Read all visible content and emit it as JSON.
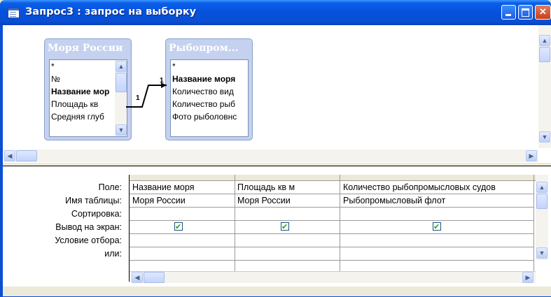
{
  "window": {
    "title": "Запрос3 : запрос на выборку"
  },
  "tables": [
    {
      "title": "Моря России",
      "fields": [
        {
          "label": "*",
          "bold": false
        },
        {
          "label": "№",
          "bold": false
        },
        {
          "label": "Название мор",
          "bold": true
        },
        {
          "label": "Площадь кв",
          "bold": false
        },
        {
          "label": "Средняя глуб",
          "bold": false
        }
      ]
    },
    {
      "title": "Рыбопром...",
      "fields": [
        {
          "label": "*",
          "bold": false
        },
        {
          "label": "Название моря",
          "bold": true
        },
        {
          "label": "Количество  вид",
          "bold": false
        },
        {
          "label": "Количество рыб",
          "bold": false
        },
        {
          "label": "Фото рыболовнс",
          "bold": false
        }
      ]
    }
  ],
  "relationship": {
    "left_label": "1",
    "right_label": "1"
  },
  "grid": {
    "row_labels": [
      "Поле:",
      "Имя таблицы:",
      "Сортировка:",
      "Вывод на экран:",
      "Условие отбора:",
      "или:"
    ],
    "columns": [
      {
        "field": "Название моря",
        "table": "Моря России",
        "sort": "",
        "show": true,
        "criteria": "",
        "or": ""
      },
      {
        "field": "Площадь кв м",
        "table": "Моря России",
        "sort": "",
        "show": true,
        "criteria": "",
        "or": ""
      },
      {
        "field": "Количество рыбопромысловых судов",
        "table": "Рыбопромысловый флот",
        "sort": "",
        "show": true,
        "criteria": "",
        "or": ""
      }
    ]
  },
  "scroll": {
    "up": "▲",
    "down": "▼",
    "left": "◀",
    "right": "▶"
  }
}
